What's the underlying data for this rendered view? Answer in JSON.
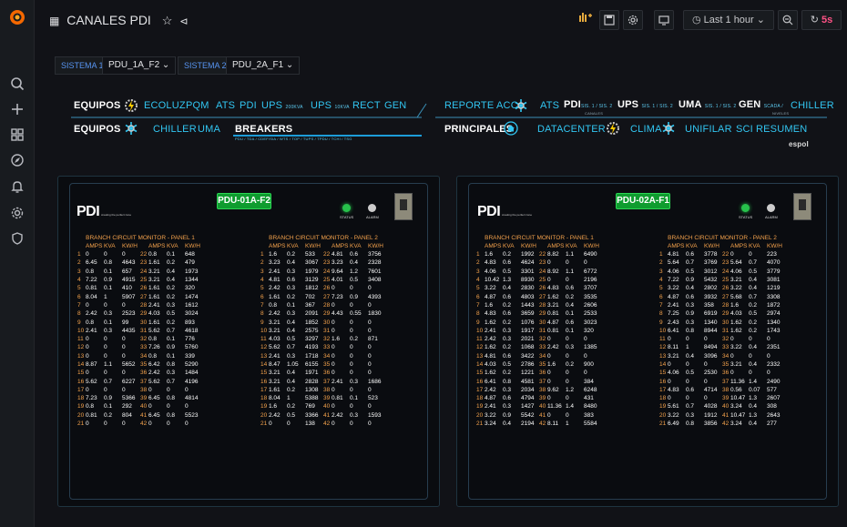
{
  "header": {
    "title": "CANALES PDI",
    "time_range": "Last 1 hour",
    "refresh": "5s"
  },
  "variables": [
    {
      "label": "SISTEMA 1",
      "value": "PDU_1A_F2"
    },
    {
      "label": "SISTEMA 2",
      "value": "PDU_2A_F1"
    }
  ],
  "nav": {
    "left_row1": {
      "title": "EQUIPOS",
      "links": [
        "ECOLUZ",
        "PQM",
        "ATS",
        "PDI",
        "UPS",
        "UPS",
        "RECT",
        "GEN"
      ],
      "ups1_sub": "200KVA",
      "ups2_sub": "10KVA"
    },
    "left_row2": {
      "title": "EQUIPOS",
      "links": [
        "CHILLER",
        "UMA"
      ],
      "breakers": "BREAKERS",
      "breakers_sub": "PDU / TDA / CDEF/SIA / WTS / TOP / TUPS / TPDU / TCHI / TSG"
    },
    "right_row1": {
      "title": "REPORTE ACC",
      "ats": "ATS",
      "pdi": "PDI",
      "pdi_sub": "SIS. 1 / SIS. 2",
      "pdi_sub2": "CANALES",
      "ups": "UPS",
      "ups_sub": "SIS. 1 / SIS. 2",
      "uma": "UMA",
      "uma_sub": "SIS. 1 / SIS. 2",
      "gen": "GEN",
      "gen_sub": "SCADA /",
      "gen_sub2": "NIVELES",
      "chiller": "CHILLER"
    },
    "right_row2": {
      "title": "PRINCIPALES",
      "links": [
        "DATACENTER",
        "CLIMA",
        "UNIFILAR",
        "SCI",
        "RESUMEN"
      ],
      "brand": "espol"
    }
  },
  "panels": [
    {
      "logo": "PDI",
      "tagline": "creating the perfect zone",
      "pdu": "PDU-01A-F2",
      "status": "STATUS",
      "alarm": "ALARM",
      "boards": [
        {
          "title": "BRANCH CIRCUIT MONITOR - PANEL 1",
          "cols": [
            "AMPS",
            "KVA",
            "KW/H",
            "AMPS",
            "KVA",
            "KW/H"
          ],
          "rows": [
            [
              "1",
              "0",
              "0",
              "0",
              "22",
              "0.8",
              "0.1",
              "648"
            ],
            [
              "2",
              "6.45",
              "0.8",
              "4643",
              "23",
              "1.61",
              "0.2",
              "479"
            ],
            [
              "3",
              "0.8",
              "0.1",
              "657",
              "24",
              "3.21",
              "0.4",
              "1973"
            ],
            [
              "4",
              "7.22",
              "0.9",
              "4915",
              "25",
              "3.21",
              "0.4",
              "1344"
            ],
            [
              "5",
              "0.81",
              "0.1",
              "410",
              "26",
              "1.61",
              "0.2",
              "320"
            ],
            [
              "6",
              "8.04",
              "1",
              "5907",
              "27",
              "1.61",
              "0.2",
              "1474"
            ],
            [
              "7",
              "0",
              "0",
              "0",
              "28",
              "2.41",
              "0.3",
              "1612"
            ],
            [
              "8",
              "2.42",
              "0.3",
              "2523",
              "29",
              "4.03",
              "0.5",
              "3024"
            ],
            [
              "9",
              "0.8",
              "0.1",
              "99",
              "30",
              "1.61",
              "0.2",
              "893"
            ],
            [
              "10",
              "2.41",
              "0.3",
              "4435",
              "31",
              "5.62",
              "0.7",
              "4618"
            ],
            [
              "11",
              "0",
              "0",
              "0",
              "32",
              "0.8",
              "0.1",
              "776"
            ],
            [
              "12",
              "0",
              "0",
              "0",
              "33",
              "7.26",
              "0.9",
              "5760"
            ],
            [
              "13",
              "0",
              "0",
              "0",
              "34",
              "0.8",
              "0.1",
              "339"
            ],
            [
              "14",
              "8.87",
              "1.1",
              "5652",
              "35",
              "6.42",
              "0.8",
              "5290"
            ],
            [
              "15",
              "0",
              "0",
              "0",
              "36",
              "2.42",
              "0.3",
              "1484"
            ],
            [
              "16",
              "5.62",
              "0.7",
              "6227",
              "37",
              "5.62",
              "0.7",
              "4196"
            ],
            [
              "17",
              "0",
              "0",
              "0",
              "38",
              "0",
              "0",
              "0"
            ],
            [
              "18",
              "7.23",
              "0.9",
              "5366",
              "39",
              "6.45",
              "0.8",
              "4814"
            ],
            [
              "19",
              "0.8",
              "0.1",
              "292",
              "40",
              "0",
              "0",
              "0"
            ],
            [
              "20",
              "0.81",
              "0.2",
              "804",
              "41",
              "6.45",
              "0.8",
              "5523"
            ],
            [
              "21",
              "0",
              "0",
              "0",
              "42",
              "0",
              "0",
              "0"
            ]
          ]
        },
        {
          "title": "BRANCH CIRCUIT MONITOR - PANEL 2",
          "cols": [
            "AMPS",
            "KVA",
            "KW/H",
            "AMPS",
            "KVA",
            "KW/H"
          ],
          "rows": [
            [
              "1",
              "1.6",
              "0.2",
              "533",
              "22",
              "4.81",
              "0.6",
              "3756"
            ],
            [
              "2",
              "3.23",
              "0.4",
              "3067",
              "23",
              "3.23",
              "0.4",
              "2328"
            ],
            [
              "3",
              "2.41",
              "0.3",
              "1979",
              "24",
              "9.64",
              "1.2",
              "7601"
            ],
            [
              "4",
              "4.81",
              "0.6",
              "3129",
              "25",
              "4.01",
              "0.5",
              "3408"
            ],
            [
              "5",
              "2.42",
              "0.3",
              "1812",
              "26",
              "0",
              "0",
              "0"
            ],
            [
              "6",
              "1.61",
              "0.2",
              "702",
              "27",
              "7.23",
              "0.9",
              "4393"
            ],
            [
              "7",
              "0.8",
              "0.1",
              "367",
              "28",
              "0",
              "0",
              "0"
            ],
            [
              "8",
              "2.42",
              "0.3",
              "2091",
              "29",
              "4.43",
              "0.55",
              "1830"
            ],
            [
              "9",
              "3.21",
              "0.4",
              "1852",
              "30",
              "0",
              "0",
              "0"
            ],
            [
              "10",
              "3.21",
              "0.4",
              "2575",
              "31",
              "0",
              "0",
              "0"
            ],
            [
              "11",
              "4.03",
              "0.5",
              "3297",
              "32",
              "1.6",
              "0.2",
              "871"
            ],
            [
              "12",
              "5.62",
              "0.7",
              "4193",
              "33",
              "0",
              "0",
              "0"
            ],
            [
              "13",
              "2.41",
              "0.3",
              "1718",
              "34",
              "0",
              "0",
              "0"
            ],
            [
              "14",
              "8.47",
              "1.05",
              "6155",
              "35",
              "0",
              "0",
              "0"
            ],
            [
              "15",
              "3.21",
              "0.4",
              "1971",
              "36",
              "0",
              "0",
              "0"
            ],
            [
              "16",
              "3.21",
              "0.4",
              "2828",
              "37",
              "2.41",
              "0.3",
              "1686"
            ],
            [
              "17",
              "1.61",
              "0.2",
              "1308",
              "38",
              "0",
              "0",
              "0"
            ],
            [
              "18",
              "8.04",
              "1",
              "5388",
              "39",
              "0.81",
              "0.1",
              "523"
            ],
            [
              "19",
              "1.6",
              "0.2",
              "769",
              "40",
              "0",
              "0",
              "0"
            ],
            [
              "20",
              "2.42",
              "0.5",
              "3366",
              "41",
              "2.42",
              "0.3",
              "1593"
            ],
            [
              "21",
              "0",
              "0",
              "138",
              "42",
              "0",
              "0",
              "0"
            ]
          ]
        }
      ]
    },
    {
      "logo": "PDI",
      "tagline": "creating the perfect zone",
      "pdu": "PDU-02A-F1",
      "status": "STATUS",
      "alarm": "ALARM",
      "boards": [
        {
          "title": "BRANCH CIRCUIT MONITOR - PANEL 1",
          "cols": [
            "AMPS",
            "KVA",
            "KW/H",
            "AMPS",
            "KVA",
            "KW/H"
          ],
          "rows": [
            [
              "1",
              "1.6",
              "0.2",
              "1992",
              "22",
              "8.82",
              "1.1",
              "6490"
            ],
            [
              "2",
              "4.83",
              "0.6",
              "4624",
              "23",
              "0",
              "0",
              "0"
            ],
            [
              "3",
              "4.06",
              "0.5",
              "3301",
              "24",
              "8.92",
              "1.1",
              "6772"
            ],
            [
              "4",
              "10.42",
              "1.3",
              "8930",
              "25",
              "0",
              "0",
              "2196"
            ],
            [
              "5",
              "3.22",
              "0.4",
              "2830",
              "26",
              "4.83",
              "0.6",
              "3707"
            ],
            [
              "6",
              "4.87",
              "0.6",
              "4803",
              "27",
              "1.62",
              "0.2",
              "3535"
            ],
            [
              "7",
              "1.6",
              "0.2",
              "1443",
              "28",
              "3.21",
              "0.4",
              "2606"
            ],
            [
              "8",
              "4.83",
              "0.6",
              "3659",
              "29",
              "0.81",
              "0.1",
              "2533"
            ],
            [
              "9",
              "1.62",
              "0.2",
              "1076",
              "30",
              "4.87",
              "0.6",
              "3023"
            ],
            [
              "10",
              "2.41",
              "0.3",
              "1917",
              "31",
              "0.81",
              "0.1",
              "320"
            ],
            [
              "11",
              "2.42",
              "0.3",
              "2021",
              "32",
              "0",
              "0",
              "0"
            ],
            [
              "12",
              "1.62",
              "0.2",
              "1068",
              "33",
              "2.42",
              "0.3",
              "1385"
            ],
            [
              "13",
              "4.81",
              "0.6",
              "3422",
              "34",
              "0",
              "0",
              "0"
            ],
            [
              "14",
              "4.03",
              "0.5",
              "2786",
              "35",
              "1.6",
              "0.2",
              "900"
            ],
            [
              "15",
              "1.62",
              "0.2",
              "1221",
              "36",
              "0",
              "0",
              "0"
            ],
            [
              "16",
              "6.41",
              "0.8",
              "4581",
              "37",
              "0",
              "0",
              "384"
            ],
            [
              "17",
              "2.42",
              "0.3",
              "2034",
              "38",
              "9.62",
              "1.2",
              "6248"
            ],
            [
              "18",
              "4.87",
              "0.6",
              "4794",
              "39",
              "0",
              "0",
              "431"
            ],
            [
              "19",
              "2.41",
              "0.3",
              "1427",
              "40",
              "11.36",
              "1.4",
              "8480"
            ],
            [
              "20",
              "3.22",
              "0.9",
              "5542",
              "41",
              "0",
              "0",
              "383"
            ],
            [
              "21",
              "3.24",
              "0.4",
              "2194",
              "42",
              "8.11",
              "1",
              "5584"
            ]
          ]
        },
        {
          "title": "BRANCH CIRCUIT MONITOR - PANEL 2",
          "cols": [
            "AMPS",
            "KVA",
            "KW/H",
            "AMPS",
            "KVA",
            "KW/H"
          ],
          "rows": [
            [
              "1",
              "4.81",
              "0.6",
              "3778",
              "22",
              "0",
              "0",
              "223"
            ],
            [
              "2",
              "5.64",
              "0.7",
              "3769",
              "23",
              "5.64",
              "0.7",
              "4070"
            ],
            [
              "3",
              "4.06",
              "0.5",
              "3012",
              "24",
              "4.06",
              "0.5",
              "3779"
            ],
            [
              "4",
              "7.22",
              "0.9",
              "5432",
              "25",
              "3.21",
              "0.4",
              "3081"
            ],
            [
              "5",
              "3.22",
              "0.4",
              "2802",
              "26",
              "3.22",
              "0.4",
              "1219"
            ],
            [
              "6",
              "4.87",
              "0.6",
              "3932",
              "27",
              "5.68",
              "0.7",
              "3308"
            ],
            [
              "7",
              "2.41",
              "0.3",
              "358",
              "28",
              "1.6",
              "0.2",
              "1872"
            ],
            [
              "8",
              "7.25",
              "0.9",
              "6919",
              "29",
              "4.03",
              "0.5",
              "2974"
            ],
            [
              "9",
              "2.43",
              "0.3",
              "1340",
              "30",
              "1.62",
              "0.2",
              "1340"
            ],
            [
              "10",
              "6.41",
              "0.8",
              "8944",
              "31",
              "1.62",
              "0.2",
              "1743"
            ],
            [
              "11",
              "0",
              "0",
              "0",
              "32",
              "0",
              "0",
              "0"
            ],
            [
              "12",
              "8.11",
              "1",
              "8494",
              "33",
              "3.22",
              "0.4",
              "2351"
            ],
            [
              "13",
              "3.21",
              "0.4",
              "3096",
              "34",
              "0",
              "0",
              "0"
            ],
            [
              "14",
              "0",
              "0",
              "0",
              "35",
              "3.21",
              "0.4",
              "2332"
            ],
            [
              "15",
              "4.06",
              "0.5",
              "2530",
              "36",
              "0",
              "0",
              "0"
            ],
            [
              "16",
              "0",
              "0",
              "0",
              "37",
              "11.36",
              "1.4",
              "2490"
            ],
            [
              "17",
              "4.83",
              "0.6",
              "4714",
              "38",
              "0.56",
              "0.07",
              "577"
            ],
            [
              "18",
              "0",
              "0",
              "0",
              "39",
              "10.47",
              "1.3",
              "2607"
            ],
            [
              "19",
              "5.61",
              "0.7",
              "4028",
              "40",
              "3.24",
              "0.4",
              "308"
            ],
            [
              "20",
              "3.22",
              "0.3",
              "1912",
              "41",
              "10.47",
              "1.3",
              "2643"
            ],
            [
              "21",
              "6.49",
              "0.8",
              "3856",
              "42",
              "3.24",
              "0.4",
              "277"
            ]
          ]
        }
      ]
    }
  ],
  "colors": {
    "accent": "#5794f2",
    "nav_cyan": "#32c6f2",
    "pdu_green": "#0f9c2f",
    "label_orange": "#f4a24c"
  }
}
